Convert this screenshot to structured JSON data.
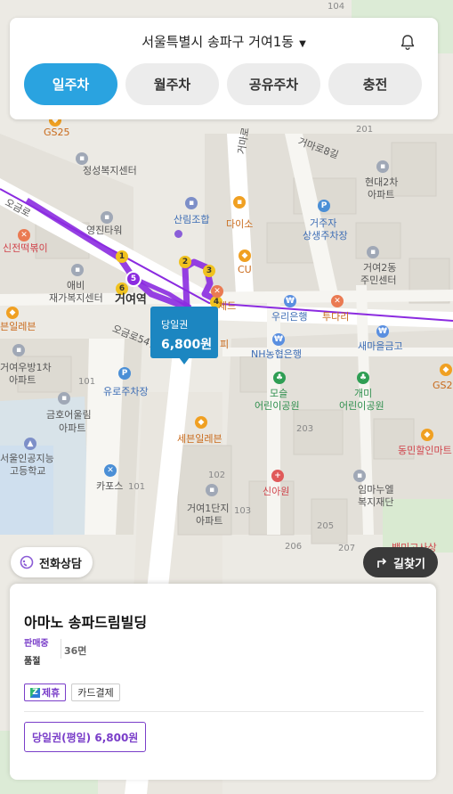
{
  "header": {
    "location": "서울특별시 송파구 거여1동",
    "tabs": [
      {
        "label": "일주차",
        "active": true
      },
      {
        "label": "월주차",
        "active": false
      },
      {
        "label": "공유주차",
        "active": false
      },
      {
        "label": "충전",
        "active": false
      }
    ]
  },
  "map": {
    "labels": {
      "gs25_a": "GS25",
      "jeongseong": "정성복지센터",
      "sillim": "산림조합",
      "yeongjin": "영진타워",
      "sinjeon": "신전떡볶이",
      "aebi": "애비",
      "jaega": "재가복지센터",
      "geoyeo_station": "거여역",
      "ogeum_ro": "오금로",
      "ogeum_ro54": "오금로54길",
      "seven_a": "븐일레븐",
      "geoyeo1_a": "거여우방1차",
      "apt_a": "아파트",
      "yuro": "유로주차장",
      "geumho": "금호어울림",
      "apt_b": "아파트",
      "seoul_ingong": "서울인공지능",
      "gogyo": "고등학교",
      "capos": "카포스",
      "seven_b": "세븐일레븐",
      "geoyeo1danji": "거여1단지",
      "apt_c": "아파트",
      "sinawon": "신아원",
      "daiso": "다이소",
      "cu": "CU",
      "geojuja": "거주자",
      "sangsaeng": "상생주차장",
      "hyundai": "현대2차",
      "apt_d": "아파트",
      "geoyeo2dong": "거여2동",
      "jumin": "주민센터",
      "woori": "우리은행",
      "tudari": "투다리",
      "nh": "NH농협은행",
      "saemaeul": "새마을금고",
      "mosl": "모슬",
      "mosl_kinder": "어린이공원",
      "gaemi": "개미",
      "gaemi_kinder": "어린이공원",
      "gs25_b": "GS25",
      "dongmin": "동민할인마트",
      "imanuel": "임마누엘",
      "bokji": "복지재단",
      "baengmi": "백미고사상",
      "geoyeo_ro": "거마로",
      "geoyeo_ro8": "거마로8길",
      "num_104": "104",
      "num_103": "103",
      "num_101": "101",
      "num_102": "102",
      "num_205": "205",
      "num_206": "206",
      "num_203": "203",
      "num_201": "201",
      "num_207": "207",
      "num_101b": "101",
      "stop_1": "1",
      "stop_2": "2",
      "stop_3": "3",
      "stop_4": "4",
      "stop_5": "5",
      "stop_6": "6",
      "pin_prefix": "피",
      "cheed": "체드"
    }
  },
  "pin": {
    "type_label": "당일권",
    "price": "6,800원"
  },
  "buttons": {
    "call": "전화상담",
    "navigate": "길찾기"
  },
  "detail": {
    "name": "아마노 송파드림빌딩",
    "status": "판매중",
    "substatus": "품절",
    "capacity": "36면",
    "tags": [
      {
        "label": "제휴",
        "partner": true
      },
      {
        "label": "카드결제",
        "partner": false
      }
    ],
    "ticket": "당일권(평일) 6,800원"
  },
  "colors": {
    "accent": "#2aa3e0",
    "pin": "#1c86c1",
    "partner": "#7a3ec9",
    "route": "#8b2be0"
  }
}
